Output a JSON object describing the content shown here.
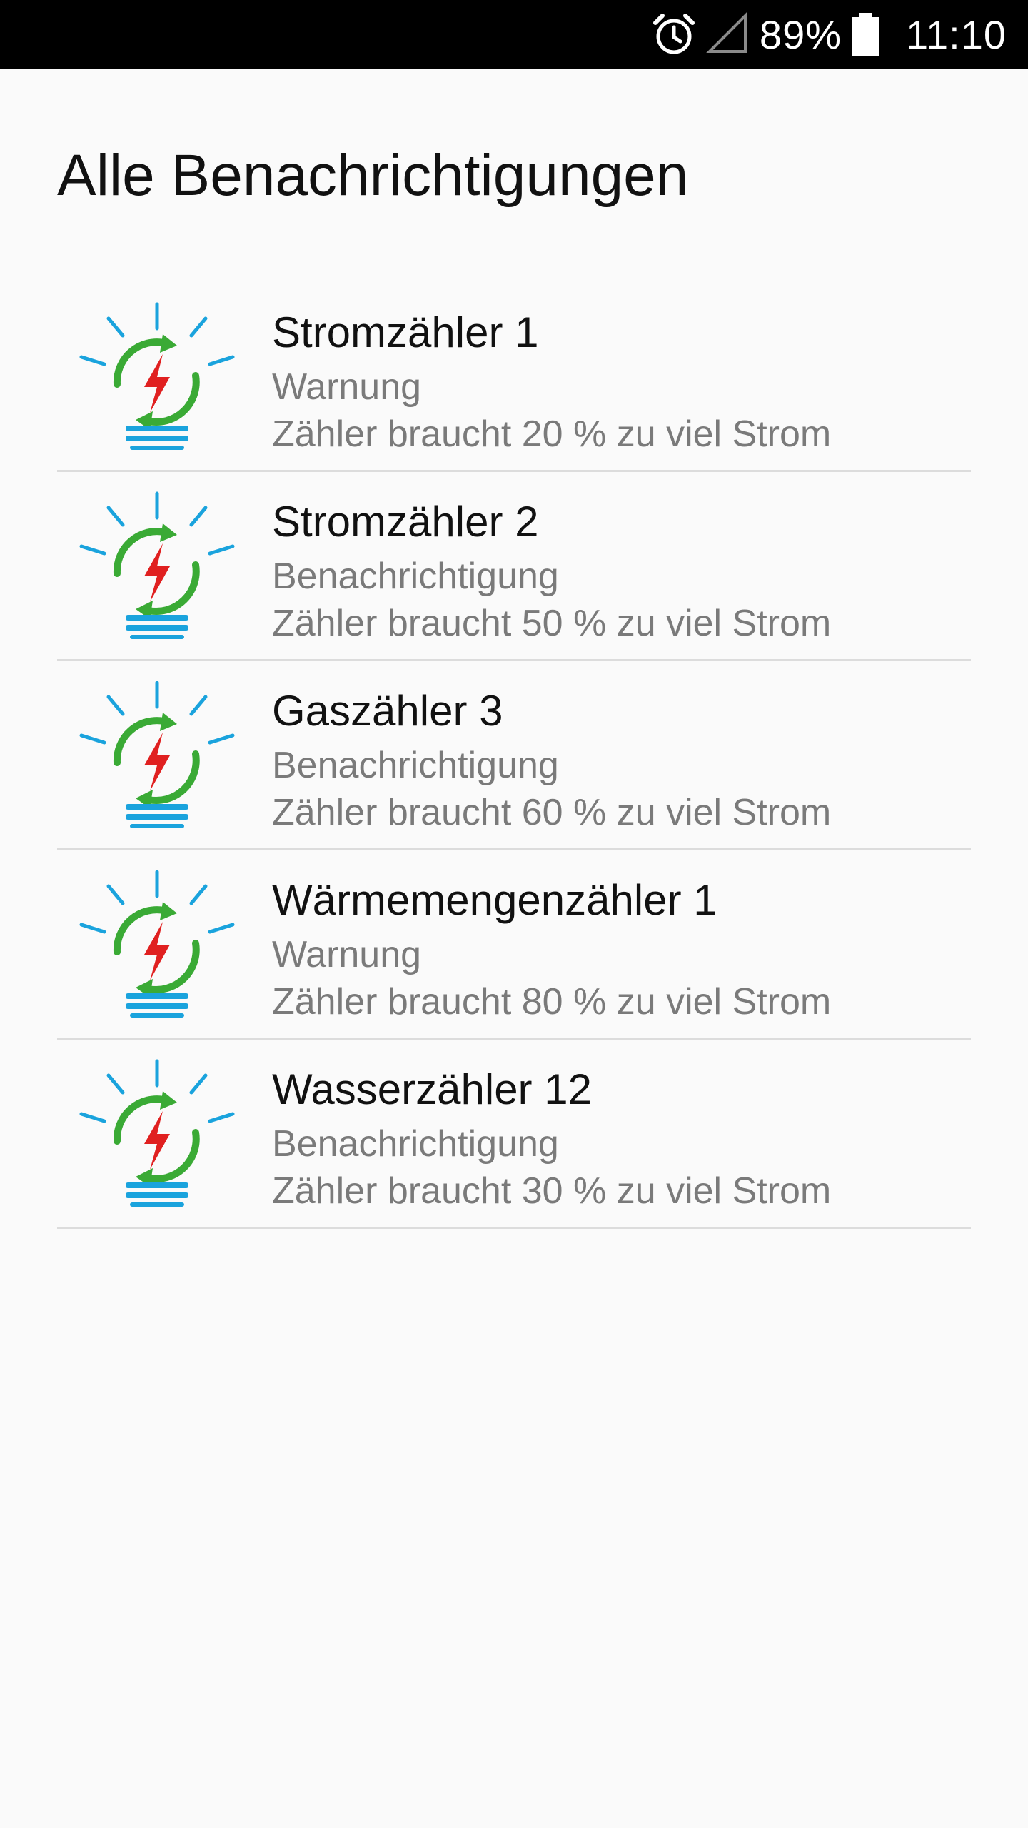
{
  "status_bar": {
    "battery_percent": "89%",
    "time": "11:10",
    "icons": [
      "alarm-clock-icon",
      "cellular-signal-icon",
      "battery-icon"
    ]
  },
  "page": {
    "title": "Alle Benachrichtigungen"
  },
  "colors": {
    "bulb_rays": "#1aa3dd",
    "bulb_arrows": "#3aaa35",
    "bolt": "#e02020",
    "bulb_base": "#1aa3dd"
  },
  "notifications": [
    {
      "icon": "energy-bulb-icon",
      "title": "Stromzähler 1",
      "type": "Warnung",
      "message": "Zähler braucht 20 % zu viel Strom"
    },
    {
      "icon": "energy-bulb-icon",
      "title": "Stromzähler 2",
      "type": "Benachrichtigung",
      "message": "Zähler braucht 50 % zu viel Strom"
    },
    {
      "icon": "energy-bulb-icon",
      "title": "Gaszähler 3",
      "type": "Benachrichtigung",
      "message": "Zähler braucht 60 % zu viel Strom"
    },
    {
      "icon": "energy-bulb-icon",
      "title": "Wärmemengenzähler 1",
      "type": "Warnung",
      "message": "Zähler braucht 80 % zu viel Strom"
    },
    {
      "icon": "energy-bulb-icon",
      "title": "Wasserzähler 12",
      "type": "Benachrichtigung",
      "message": "Zähler braucht 30 % zu viel Strom"
    }
  ]
}
